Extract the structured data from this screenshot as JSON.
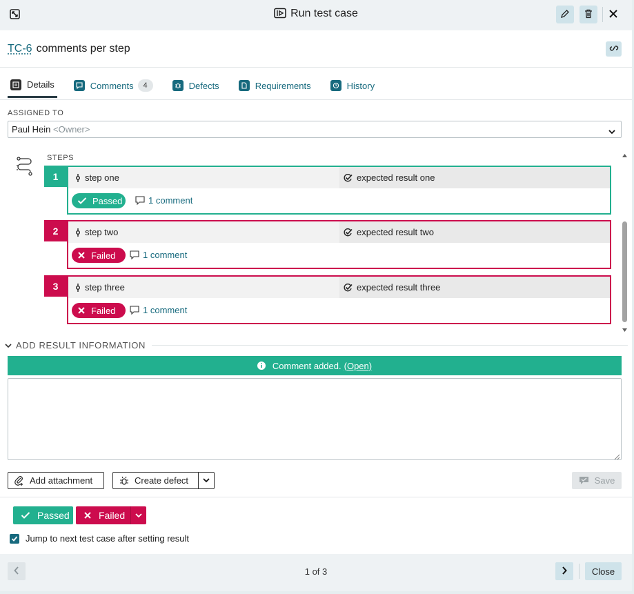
{
  "dialog": {
    "title": "Run test case"
  },
  "test_case": {
    "id": "TC-6",
    "name": "comments per step"
  },
  "tabs": [
    {
      "label": "Details",
      "active": true
    },
    {
      "label": "Comments",
      "count": "4"
    },
    {
      "label": "Defects"
    },
    {
      "label": "Requirements"
    },
    {
      "label": "History"
    }
  ],
  "assigned": {
    "label": "ASSIGNED TO",
    "name": "Paul Hein",
    "role": "<Owner>"
  },
  "steps": {
    "label": "STEPS",
    "items": [
      {
        "num": "1",
        "action": "step one",
        "expected": "expected result one",
        "status": "Passed",
        "comments": "1 comment"
      },
      {
        "num": "2",
        "action": "step two",
        "expected": "expected result two",
        "status": "Failed",
        "comments": "1 comment"
      },
      {
        "num": "3",
        "action": "step three",
        "expected": "expected result three",
        "status": "Failed",
        "comments": "1 comment"
      }
    ]
  },
  "result_info": {
    "label": "ADD RESULT INFORMATION",
    "banner_text": "Comment added.",
    "banner_link": "(Open)",
    "comment_value": ""
  },
  "actions": {
    "add_attachment": "Add attachment",
    "create_defect": "Create defect",
    "save": "Save"
  },
  "results": {
    "passed": "Passed",
    "failed": "Failed"
  },
  "jump": {
    "label": "Jump to next test case after setting result",
    "checked": true
  },
  "footer": {
    "pager": "1 of 3",
    "close": "Close"
  },
  "colors": {
    "accent": "#176a7e",
    "passed": "#22b08f",
    "failed": "#cc0c4d"
  }
}
